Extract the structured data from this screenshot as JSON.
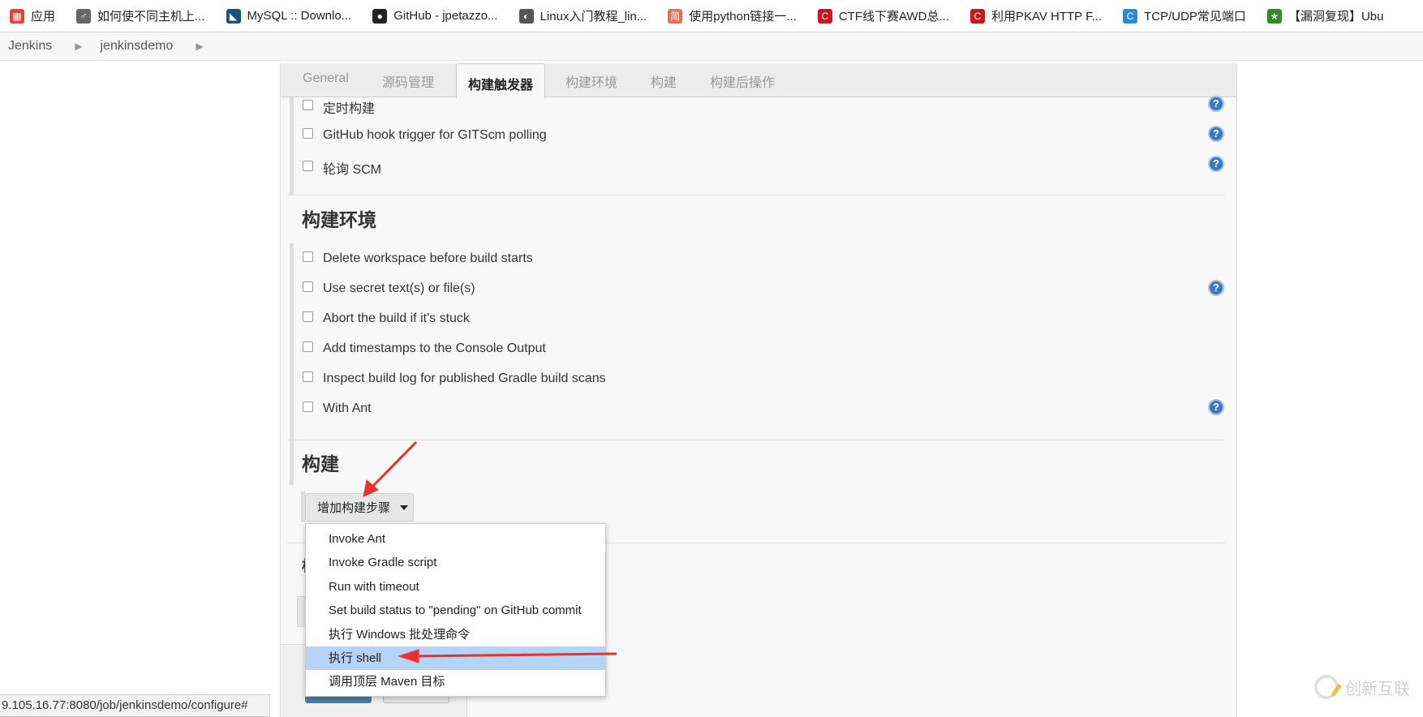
{
  "bookmarks": [
    {
      "label": "应用",
      "icon": "apps-grid-icon",
      "color": "#e94235"
    },
    {
      "label": "如何使不同主机上...",
      "icon": "person-icon",
      "color": "#666666"
    },
    {
      "label": "MySQL :: Downlo...",
      "icon": "mysql-icon",
      "color": "#1c4f7b"
    },
    {
      "label": "GitHub - jpetazzo...",
      "icon": "github-icon",
      "color": "#222222"
    },
    {
      "label": "Linux入门教程_lin...",
      "icon": "globe-icon",
      "color": "#555555"
    },
    {
      "label": "使用python链接一...",
      "icon": "jianshu-icon",
      "color": "#ea6f5a"
    },
    {
      "label": "CTF线下赛AWD总...",
      "icon": "csdn-icon",
      "color": "#c9171e"
    },
    {
      "label": "利用PKAV HTTP F...",
      "icon": "csdn-icon",
      "color": "#c9171e"
    },
    {
      "label": "TCP/UDP常见端口",
      "icon": "c-icon",
      "color": "#2a8ad8"
    },
    {
      "label": "【漏洞复现】Ubu",
      "icon": "star-icon",
      "color": "#2e8b2e"
    }
  ],
  "breadcrumb": [
    "Jenkins",
    "jenkinsdemo"
  ],
  "tabs": [
    "General",
    "源码管理",
    "构建触发器",
    "构建环境",
    "构建",
    "构建后操作"
  ],
  "active_tab": "构建触发器",
  "triggers": [
    "定时构建",
    "GitHub hook trigger for GITScm polling",
    "轮询 SCM"
  ],
  "env_heading": "构建环境",
  "env_options": [
    "Delete workspace before build starts",
    "Use secret text(s) or file(s)",
    "Abort the build if it's stuck",
    "Add timestamps to the Console Output",
    "Inspect build log for published Gradle build scans",
    "With Ant"
  ],
  "build_heading": "构建",
  "add_step_label": "增加构建步骤",
  "menu_items": [
    "Invoke Ant",
    "Invoke Gradle script",
    "Run with timeout",
    "Set build status to \"pending\" on GitHub commit",
    "执行 Windows 批处理命令",
    "执行 shell",
    "调用顶层 Maven 目标"
  ],
  "highlighted_item": "执行 shell",
  "status_url": "9.105.16.77:8080/job/jenkinsdemo/configure#",
  "watermark": "创新互联",
  "colors": {
    "help": "#3a78c3",
    "highlight": "#b5d3f6",
    "arrow": "#e8302e"
  }
}
